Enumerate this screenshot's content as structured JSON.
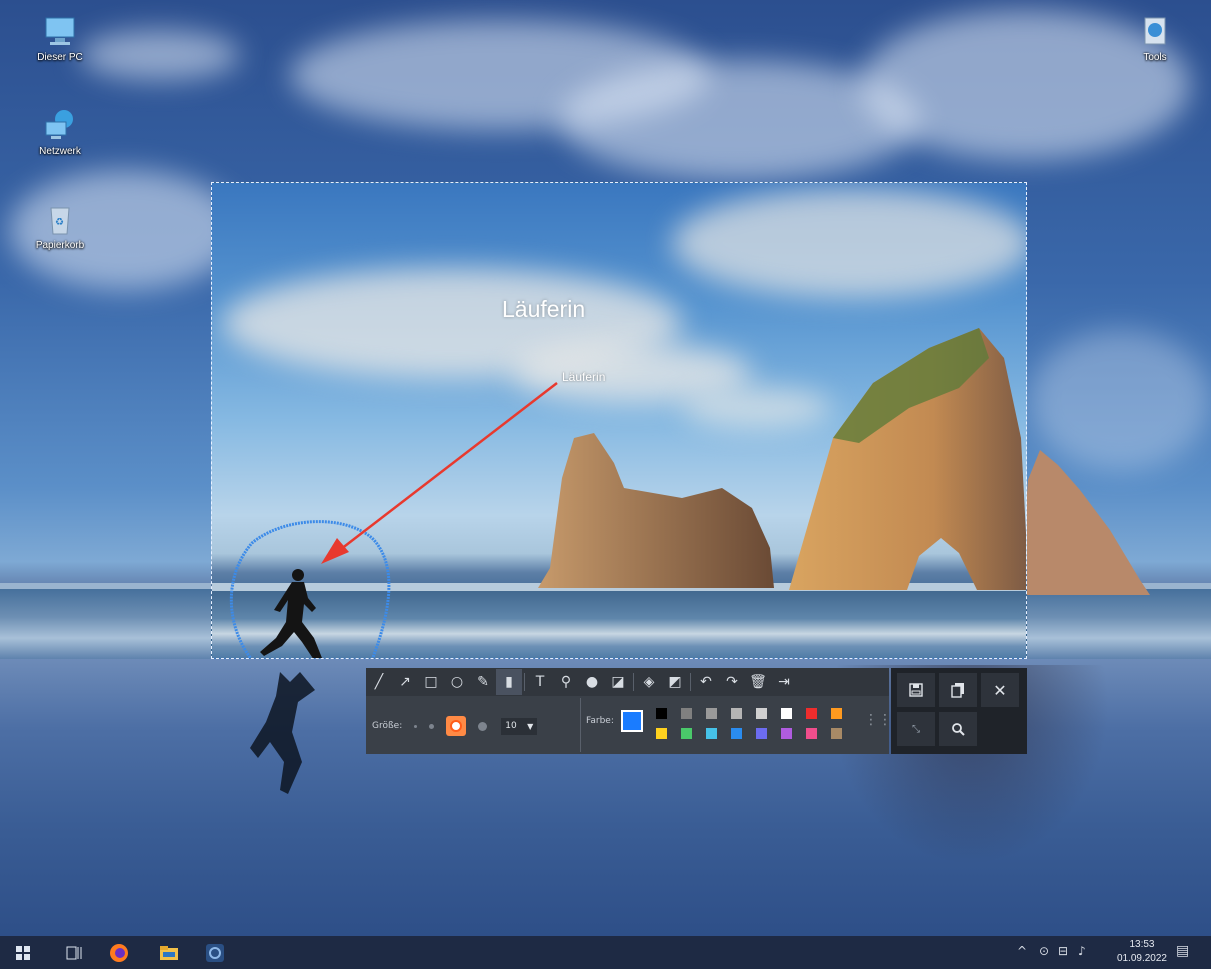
{
  "desktop": {
    "icons": [
      {
        "label": "Dieser PC",
        "icon": "computer-icon"
      },
      {
        "label": "Netzwerk",
        "icon": "network-icon"
      },
      {
        "label": "Papierkorb",
        "icon": "recycle-bin-icon"
      },
      {
        "label": "Tools",
        "icon": "tools-icon"
      }
    ]
  },
  "capture": {
    "annotation_large": "Läuferin",
    "annotation_small": "Läuferin",
    "arrow_color": "#e8392e",
    "circle_color": "#3d8be8"
  },
  "toolbar": {
    "tools": [
      {
        "icon": "line-icon",
        "glyph": "╱"
      },
      {
        "icon": "arrow-icon",
        "glyph": "↗"
      },
      {
        "icon": "rectangle-icon",
        "glyph": "□"
      },
      {
        "icon": "ellipse-icon",
        "glyph": "○"
      },
      {
        "icon": "pen-icon",
        "glyph": "✎"
      },
      {
        "icon": "marker-icon",
        "glyph": "▮"
      },
      {
        "icon": "text-icon",
        "glyph": "T"
      },
      {
        "icon": "pin-icon",
        "glyph": "⚲"
      },
      {
        "icon": "blur-drop-icon",
        "glyph": "●"
      },
      {
        "icon": "fill-icon",
        "glyph": "◪"
      },
      {
        "icon": "eraser-icon",
        "glyph": "◈"
      },
      {
        "icon": "clear-icon",
        "glyph": "◩"
      },
      {
        "icon": "undo-icon",
        "glyph": "↶"
      },
      {
        "icon": "redo-icon",
        "glyph": "↷"
      },
      {
        "icon": "delete-icon",
        "glyph": "🗑"
      },
      {
        "icon": "exit-icon",
        "glyph": "⇥"
      }
    ],
    "size_label": "Größe:",
    "size_value": "10",
    "color_label": "Farbe:",
    "current_color": "#1a7cff",
    "palette": [
      [
        "#000000",
        "#808080",
        "#9a9a9a",
        "#b5b5b5",
        "#d0d0d0",
        "#ffffff",
        "#ee2d2d",
        "#ff9a1f"
      ],
      [
        "#ffd21f",
        "#4ac96a",
        "#46c2e8",
        "#2a8cf0",
        "#6c6cf0",
        "#b05ce0",
        "#f04e8c",
        "#a88a66"
      ]
    ]
  },
  "actions": {
    "save_icon": "save-icon",
    "copy_icon": "copy-icon",
    "close_icon": "close-icon",
    "fullscreen_icon": "fullscreen-icon",
    "search_icon": "search-icon"
  },
  "taskbar": {
    "time": "13:53",
    "date": "01.09.2022"
  }
}
